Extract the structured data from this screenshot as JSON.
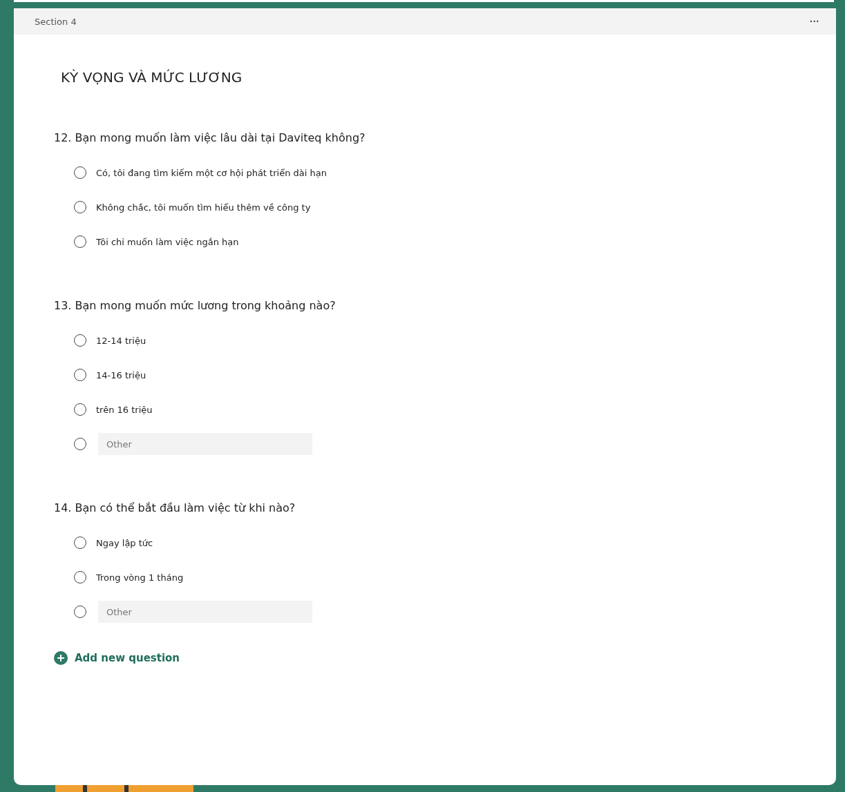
{
  "section": {
    "label": "Section 4",
    "menu": "···"
  },
  "title": "KỲ VỌNG VÀ MỨC LƯƠNG",
  "questions": [
    {
      "number": "12.",
      "text": "Bạn mong muốn làm việc lâu dài tại Daviteq không?",
      "options": [
        {
          "kind": "choice",
          "label": "Có, tôi đang tìm kiếm một cơ hội phát triển dài hạn",
          "selected": false
        },
        {
          "kind": "choice",
          "label": "Không chắc, tôi muốn tìm hiểu thêm về công ty",
          "selected": false
        },
        {
          "kind": "choice",
          "label": "Tôi chỉ muốn làm việc ngắn hạn",
          "selected": false
        }
      ]
    },
    {
      "number": "13.",
      "text": "Bạn mong muốn mức lương trong khoảng nào?",
      "options": [
        {
          "kind": "choice",
          "label": "12-14 triệu",
          "selected": false
        },
        {
          "kind": "choice",
          "label": "14-16 triệu",
          "selected": false
        },
        {
          "kind": "choice",
          "label": "trên 16 triệu",
          "selected": false
        },
        {
          "kind": "other",
          "placeholder": "Other",
          "selected": false
        }
      ]
    },
    {
      "number": "14.",
      "text": "Bạn có thể bắt đầu làm việc từ khi nào?",
      "options": [
        {
          "kind": "choice",
          "label": "Ngay lập tức",
          "selected": false
        },
        {
          "kind": "choice",
          "label": "Trong vòng 1 tháng",
          "selected": false
        },
        {
          "kind": "other",
          "placeholder": "Other",
          "selected": false
        }
      ]
    }
  ],
  "add_question": "Add new question"
}
